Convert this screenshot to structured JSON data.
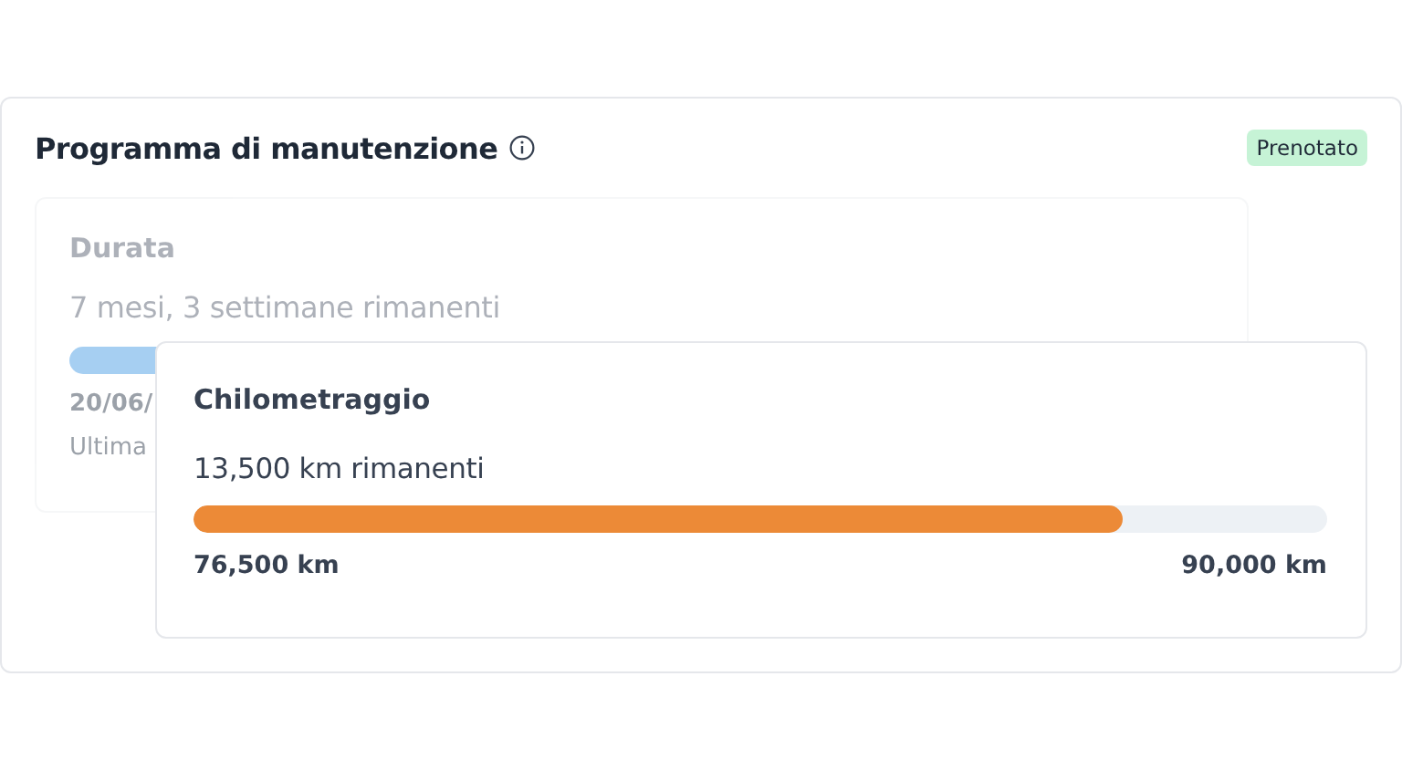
{
  "title": "Programma di manutenzione",
  "status_badge": "Prenotato",
  "duration_card": {
    "title": "Durata",
    "remaining": "7 mesi, 3 settimane rimanenti",
    "date": "20/06/",
    "note": "Ultima"
  },
  "mileage_card": {
    "title": "Chilometraggio",
    "remaining": "13,500 km rimanenti",
    "level": 0.82,
    "current": "76,500 km",
    "limit": "90,000 km"
  }
}
